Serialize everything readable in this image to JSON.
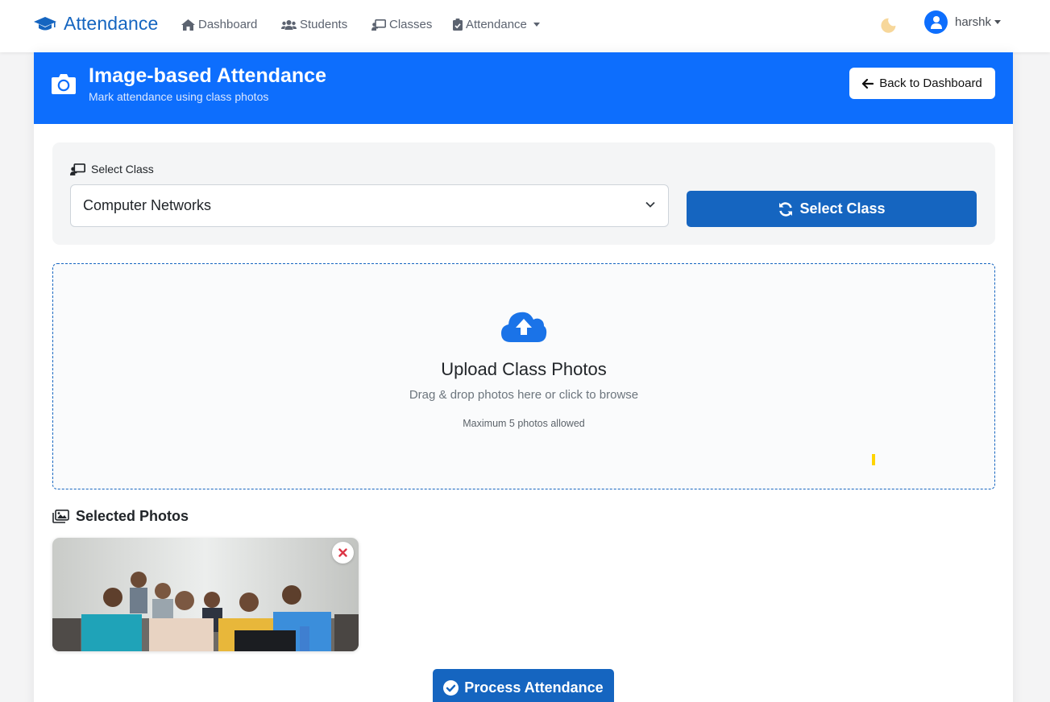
{
  "navbar": {
    "brand": "Attendance",
    "items": [
      {
        "label": "Dashboard",
        "icon": "home-icon"
      },
      {
        "label": "Students",
        "icon": "users-icon"
      },
      {
        "label": "Classes",
        "icon": "chalkboard-icon"
      },
      {
        "label": "Attendance",
        "icon": "clipboard-check-icon"
      }
    ],
    "theme_toggle_icon": "moon-icon",
    "user": {
      "name": "harshk",
      "icon": "user-circle-icon"
    }
  },
  "header": {
    "title": "Image-based Attendance",
    "subtitle": "Mark attendance using class photos",
    "back_button": "Back to Dashboard"
  },
  "class_select": {
    "label": "Select Class",
    "selected": "Computer Networks",
    "button": "Select Class"
  },
  "upload": {
    "title": "Upload Class Photos",
    "subtitle": "Drag & drop photos here or click to browse",
    "limit": "Maximum 5 photos allowed"
  },
  "selected_photos": {
    "title": "Selected Photos",
    "count": 1
  },
  "process_button": "Process Attendance",
  "colors": {
    "primary": "#0d6efd",
    "button": "#1565c0",
    "danger": "#dc3545"
  }
}
